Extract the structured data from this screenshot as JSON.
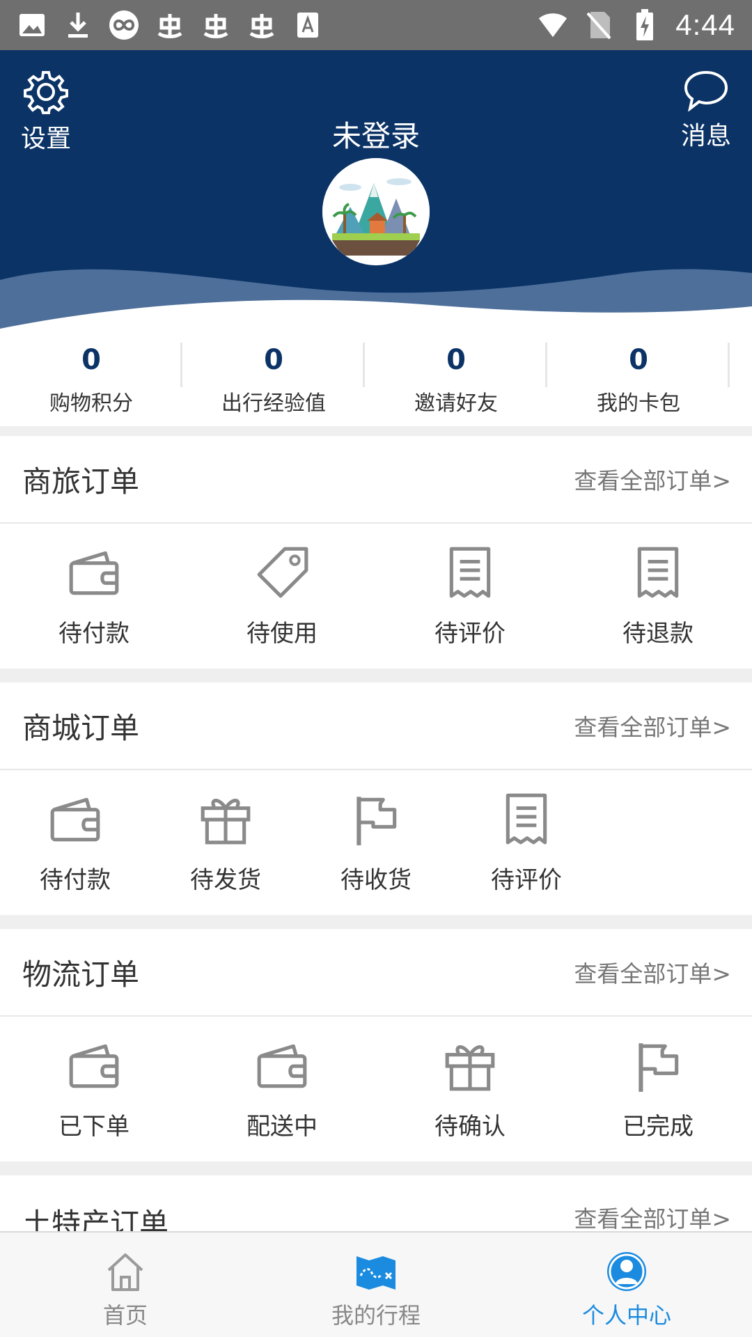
{
  "status_bar": {
    "time": "4:44",
    "left_icons": [
      "image-icon",
      "download-icon",
      "infinity-icon",
      "bug-icon",
      "bug-icon",
      "bug-icon",
      "a-box-icon"
    ],
    "right_icons": [
      "wifi-icon",
      "no-sim-icon",
      "battery-charging-icon"
    ]
  },
  "header": {
    "title": "未登录",
    "settings_label": "设置",
    "message_label": "消息",
    "bg_color": "#0b3366"
  },
  "stats": [
    {
      "value": "0",
      "label": "购物积分"
    },
    {
      "value": "0",
      "label": "出行经验值"
    },
    {
      "value": "0",
      "label": "邀请好友"
    },
    {
      "value": "0",
      "label": "我的卡包"
    }
  ],
  "sections": [
    {
      "title": "商旅订单",
      "link": "查看全部订单>",
      "items": [
        {
          "label": "待付款",
          "icon": "wallet-icon"
        },
        {
          "label": "待使用",
          "icon": "tag-icon"
        },
        {
          "label": "待评价",
          "icon": "receipt-icon"
        },
        {
          "label": "待退款",
          "icon": "receipt-icon"
        }
      ]
    },
    {
      "title": "商城订单",
      "link": "查看全部订单>",
      "items": [
        {
          "label": "待付款",
          "icon": "wallet-icon"
        },
        {
          "label": "待发货",
          "icon": "gift-icon"
        },
        {
          "label": "待收货",
          "icon": "flag-icon"
        },
        {
          "label": "待评价",
          "icon": "receipt-icon"
        }
      ]
    },
    {
      "title": "物流订单",
      "link": "查看全部订单>",
      "items": [
        {
          "label": "已下单",
          "icon": "wallet-icon"
        },
        {
          "label": "配送中",
          "icon": "wallet-icon"
        },
        {
          "label": "待确认",
          "icon": "gift-icon"
        },
        {
          "label": "已完成",
          "icon": "flag-icon"
        }
      ]
    },
    {
      "title": "土特产订单",
      "link": "查看全部订单>"
    }
  ],
  "bottom_nav": [
    {
      "label": "首页",
      "icon": "home-icon",
      "active": false
    },
    {
      "label": "我的行程",
      "icon": "map-icon",
      "active": false
    },
    {
      "label": "个人中心",
      "icon": "user-icon",
      "active": true
    }
  ],
  "colors": {
    "accent": "#1b8be0",
    "header": "#0b3366",
    "icon_gray": "#8a8a8a"
  }
}
